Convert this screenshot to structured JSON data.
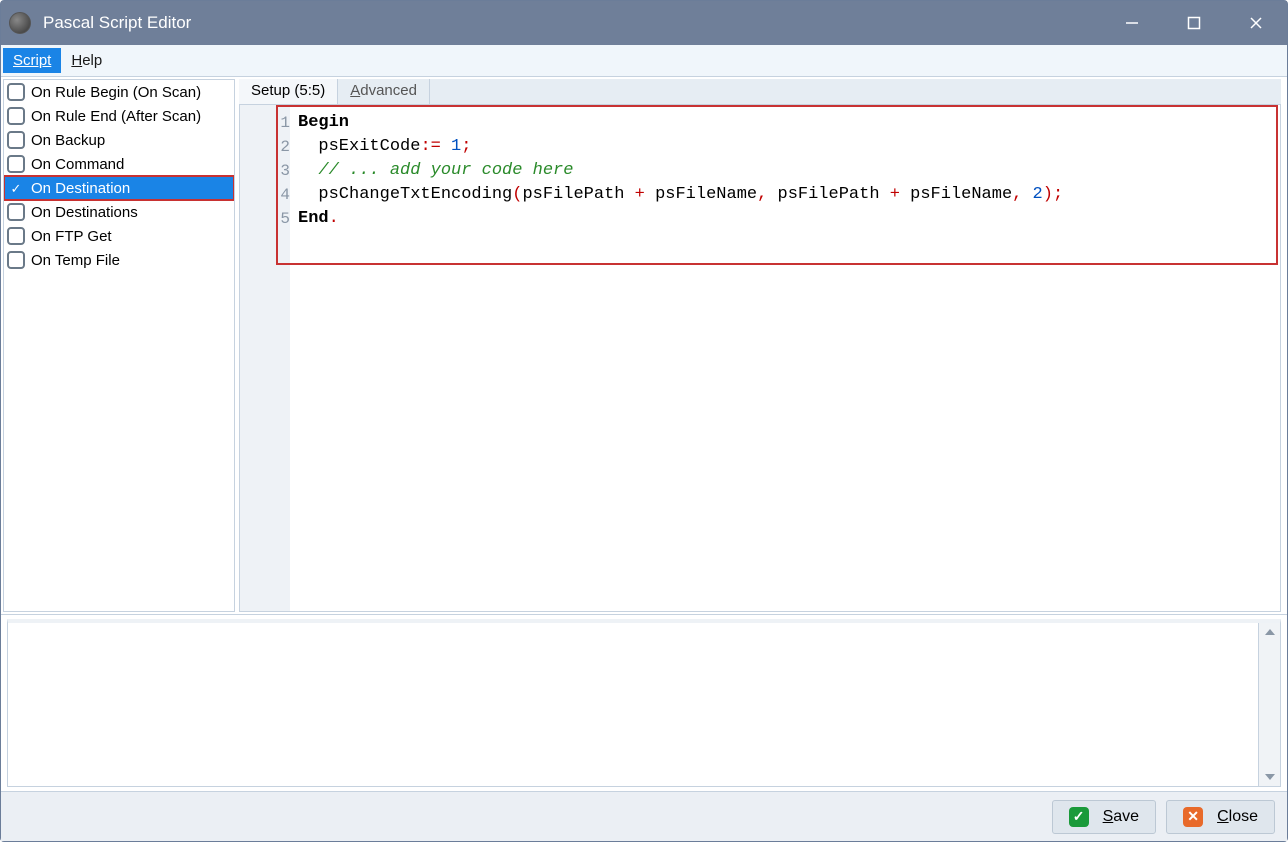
{
  "window": {
    "title": "Pascal Script Editor"
  },
  "menu": {
    "script": "Script",
    "help_u": "H",
    "help_rest": "elp"
  },
  "sidebar": {
    "items": [
      {
        "label": "On Rule Begin (On Scan)",
        "checked": false,
        "selected": false,
        "highlight": false
      },
      {
        "label": "On Rule End (After Scan)",
        "checked": false,
        "selected": false,
        "highlight": false
      },
      {
        "label": "On Backup",
        "checked": false,
        "selected": false,
        "highlight": false
      },
      {
        "label": "On Command",
        "checked": false,
        "selected": false,
        "highlight": false
      },
      {
        "label": "On Destination",
        "checked": true,
        "selected": true,
        "highlight": true
      },
      {
        "label": "On Destinations",
        "checked": false,
        "selected": false,
        "highlight": false
      },
      {
        "label": "On FTP Get",
        "checked": false,
        "selected": false,
        "highlight": false
      },
      {
        "label": "On Temp File",
        "checked": false,
        "selected": false,
        "highlight": false
      }
    ]
  },
  "tabs": {
    "setup_label": "Setup (5:5)",
    "advanced_u": "A",
    "advanced_rest": "dvanced"
  },
  "code": {
    "line_numbers": [
      "1",
      "2",
      "3",
      "4",
      "5"
    ],
    "l1_kw": "Begin",
    "l2_indent": "  ",
    "l2_a": "psExitCode",
    "l2_op": ":=",
    "l2_sp": " ",
    "l2_num": "1",
    "l2_semi": ";",
    "l3_indent": "  ",
    "l3_cmt": "// ... add your code here",
    "l4_indent": "  ",
    "l4_a": "psChangeTxtEncoding",
    "l4_lp": "(",
    "l4_b": "psFilePath ",
    "l4_plus1": "+",
    "l4_c": " psFileName",
    "l4_comma1": ",",
    "l4_d": " psFilePath ",
    "l4_plus2": "+",
    "l4_e": " psFileName",
    "l4_comma2": ",",
    "l4_sp": " ",
    "l4_num": "2",
    "l4_rp": ")",
    "l4_semi": ";",
    "l5_kw": "End",
    "l5_dot": "."
  },
  "footer": {
    "save_u": "S",
    "save_rest": "ave",
    "close_u": "C",
    "close_rest": "lose"
  }
}
